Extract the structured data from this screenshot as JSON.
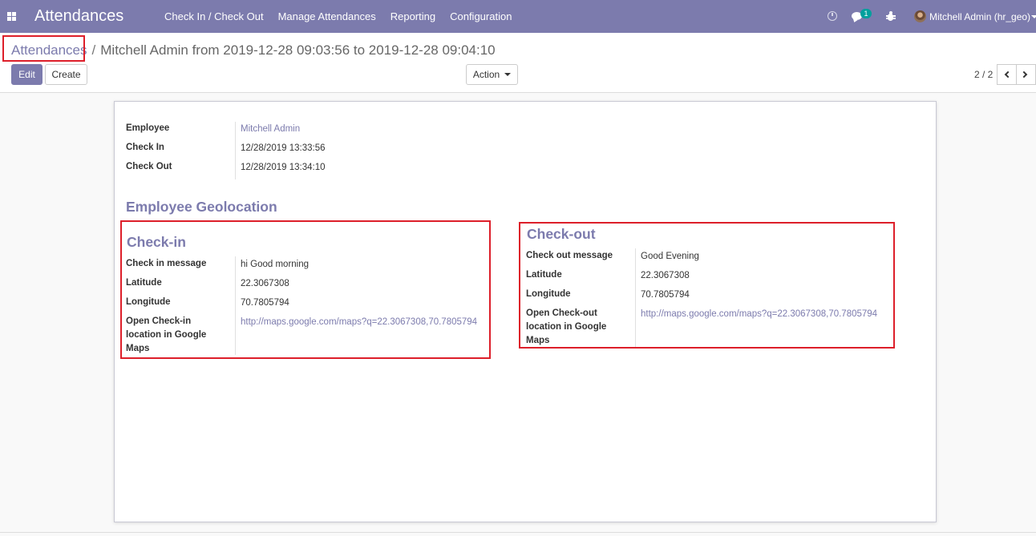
{
  "navbar": {
    "brand": "Attendances",
    "menu": [
      "Check In / Check Out",
      "Manage Attendances",
      "Reporting",
      "Configuration"
    ],
    "chat_badge": "1",
    "user": "Mitchell Admin (hr_geo)"
  },
  "breadcrumb": {
    "parent": "Attendances",
    "separator": "/",
    "current": "Mitchell Admin from 2019-12-28 09:03:56 to 2019-12-28 09:04:10"
  },
  "buttons": {
    "edit": "Edit",
    "create": "Create",
    "action": "Action"
  },
  "pager": {
    "value": "2 / 2"
  },
  "form": {
    "employee": {
      "label": "Employee",
      "value": "Mitchell Admin"
    },
    "check_in": {
      "label": "Check In",
      "value": "12/28/2019 13:33:56"
    },
    "check_out": {
      "label": "Check Out",
      "value": "12/28/2019 13:34:10"
    },
    "geo_title": "Employee Geolocation",
    "checkin_section": {
      "title": "Check-in",
      "message_label": "Check in message",
      "message": "hi Good morning",
      "latitude_label": "Latitude",
      "latitude": "22.3067308",
      "longitude_label": "Longitude",
      "longitude": "70.7805794",
      "map_label_lines": [
        "Open Check-in",
        "location in Google",
        "Maps"
      ],
      "map_url": "http://maps.google.com/maps?q=22.3067308,70.7805794"
    },
    "checkout_section": {
      "title": "Check-out",
      "message_label": "Check out message",
      "message": "Good Evening",
      "latitude_label": "Latitude",
      "latitude": "22.3067308",
      "longitude_label": "Longitude",
      "longitude": "70.7805794",
      "map_label_lines": [
        "Open Check-out",
        "location in Google",
        "Maps"
      ],
      "map_url": "http://maps.google.com/maps?q=22.3067308,70.7805794"
    }
  },
  "colors": {
    "navbar": "#7c7bad",
    "accent": "#7c7bad",
    "highlight": "#dd1f2a",
    "badge": "#00a09d"
  }
}
